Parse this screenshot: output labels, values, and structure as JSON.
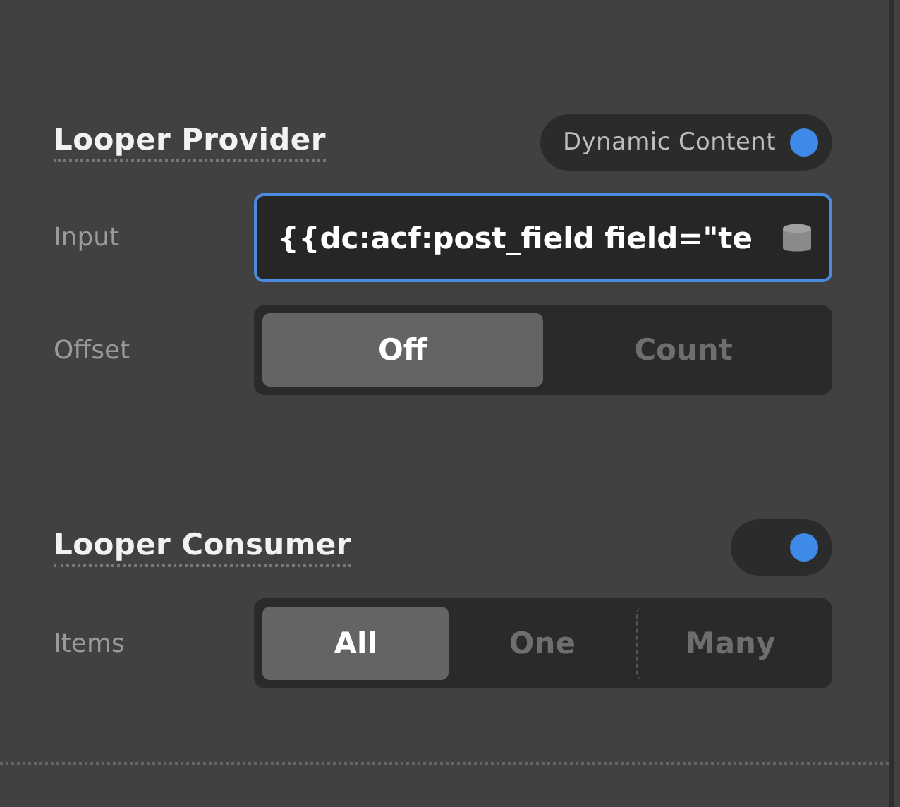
{
  "sections": [
    {
      "title": "Looper Provider",
      "toggle": {
        "label": "Dynamic Content",
        "on": true
      },
      "rows": [
        {
          "kind": "field",
          "label": "Input",
          "value": "{{dc:acf:post_field field=\"te",
          "focused": true
        },
        {
          "kind": "segmented",
          "label": "Offset",
          "options": [
            {
              "label": "Off",
              "selected": true
            },
            {
              "label": "Count",
              "selected": false
            }
          ]
        }
      ]
    },
    {
      "title": "Looper Consumer",
      "toggle": {
        "on": true
      },
      "rows": [
        {
          "kind": "segmented",
          "label": "Items",
          "options": [
            {
              "label": "All",
              "selected": true
            },
            {
              "label": "One",
              "selected": false
            },
            {
              "label": "Many",
              "selected": false
            }
          ]
        }
      ]
    }
  ]
}
